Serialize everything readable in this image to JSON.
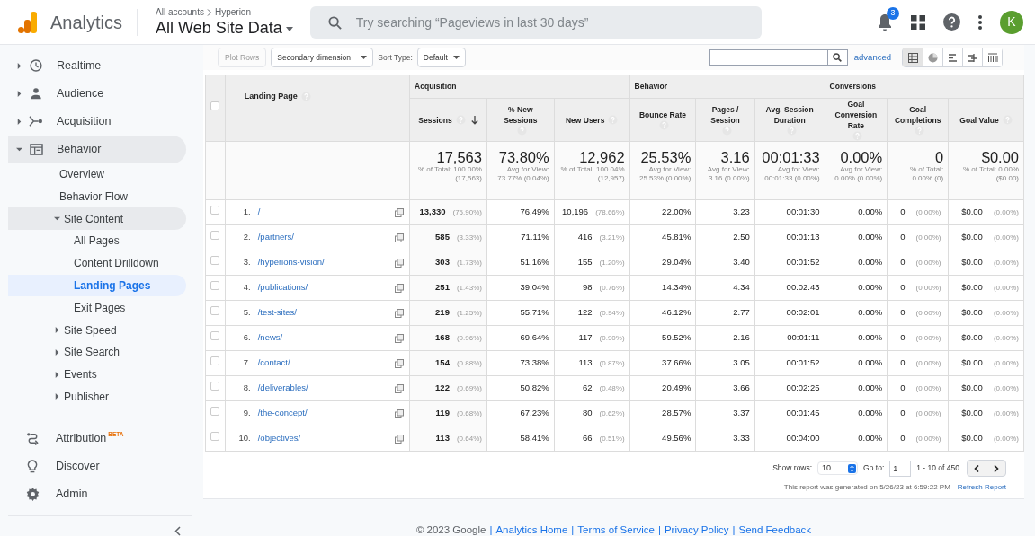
{
  "header": {
    "product": "Analytics",
    "breadcrumb": [
      "All accounts",
      "Hyperion"
    ],
    "property": "All Web Site Data",
    "search": {
      "placeholder": "Try searching “Pageviews in last 30 days”"
    },
    "notification_count": "3",
    "avatar_letter": "K"
  },
  "sidebar": {
    "items": [
      {
        "label": "Realtime",
        "expanded": false,
        "selected": false
      },
      {
        "label": "Audience",
        "expanded": false,
        "selected": false
      },
      {
        "label": "Acquisition",
        "expanded": false,
        "selected": false
      },
      {
        "label": "Behavior",
        "expanded": true,
        "selected": false,
        "children": [
          {
            "label": "Overview",
            "selected": false
          },
          {
            "label": "Behavior Flow",
            "selected": false
          },
          {
            "label": "Site Content",
            "expanded": true,
            "selected": false,
            "children": [
              {
                "label": "All Pages",
                "selected": false
              },
              {
                "label": "Content Drilldown",
                "selected": false
              },
              {
                "label": "Landing Pages",
                "selected": true
              },
              {
                "label": "Exit Pages",
                "selected": false
              }
            ]
          },
          {
            "label": "Site Speed",
            "expanded": false,
            "selected": false
          },
          {
            "label": "Site Search",
            "expanded": false,
            "selected": false
          },
          {
            "label": "Events",
            "expanded": false,
            "selected": false
          },
          {
            "label": "Publisher",
            "expanded": false,
            "selected": false
          }
        ]
      }
    ],
    "bottom_items": [
      {
        "label": "Attribution",
        "badge": "BETA",
        "selected": false
      },
      {
        "label": "Discover",
        "selected": false
      },
      {
        "label": "Admin",
        "selected": false
      }
    ]
  },
  "toolbar": {
    "plot_rows": {
      "label": "Plot Rows",
      "disabled": true
    },
    "secondary_dimension": "Secondary dimension",
    "sort_type_label": "Sort Type:",
    "sort_type": "Default",
    "advanced_link": "advanced",
    "views": [
      {
        "selected": true
      },
      {
        "selected": false
      },
      {
        "selected": false
      },
      {
        "selected": false
      },
      {
        "selected": false
      }
    ]
  },
  "table": {
    "header_checkbox": {
      "checked": false
    },
    "dimension": {
      "label": "Landing Page",
      "help": true
    },
    "groups": [
      {
        "label": "Acquisition",
        "columns": [
          {
            "label": "Sessions",
            "help": true,
            "sorted": true
          },
          {
            "label": "% New Sessions",
            "help": true,
            "sorted": false
          },
          {
            "label": "New Users",
            "help": true,
            "sorted": false
          }
        ]
      },
      {
        "label": "Behavior",
        "columns": [
          {
            "label": "Bounce Rate",
            "help": true,
            "sorted": false
          },
          {
            "label": "Pages / Session",
            "help": true,
            "sorted": false
          },
          {
            "label": "Avg. Session Duration",
            "help": true,
            "sorted": false
          }
        ]
      },
      {
        "label": "Conversions",
        "columns": [
          {
            "label": "Goal Conversion Rate",
            "help": true,
            "sorted": false
          },
          {
            "label": "Goal Completions",
            "help": true,
            "sorted": false
          },
          {
            "label": "Goal Value",
            "help": true,
            "sorted": false
          }
        ]
      }
    ],
    "totals": [
      {
        "value": "17,563",
        "note": "% of Total: 100.00% (17,563)"
      },
      {
        "value": "73.80%",
        "note": "Avg for View: 73.77% (0.04%)"
      },
      {
        "value": "12,962",
        "note": "% of Total: 100.04% (12,957)"
      },
      {
        "value": "25.53%",
        "note": "Avg for View: 25.53% (0.00%)"
      },
      {
        "value": "3.16",
        "note": "Avg for View: 3.16 (0.00%)"
      },
      {
        "value": "00:01:33",
        "note": "Avg for View: 00:01:33 (0.00%)"
      },
      {
        "value": "0.00%",
        "note": "Avg for View: 0.00% (0.00%)"
      },
      {
        "value": "0",
        "note": "% of Total: 0.00% (0)"
      },
      {
        "value": "$0.00",
        "note": "% of Total: 0.00% ($0.00)"
      }
    ],
    "rows": [
      {
        "checked": false,
        "index": "1.",
        "page": "/",
        "cells": [
          [
            "13,330",
            "(75.90%)"
          ],
          [
            "76.49%"
          ],
          [
            "10,196",
            "(78.66%)"
          ],
          [
            "22.00%"
          ],
          [
            "3.23"
          ],
          [
            "00:01:30"
          ],
          [
            "0.00%"
          ],
          [
            "0",
            "(0.00%)"
          ],
          [
            "$0.00",
            "(0.00%)"
          ]
        ]
      },
      {
        "checked": false,
        "index": "2.",
        "page": "/partners/",
        "cells": [
          [
            "585",
            "(3.33%)"
          ],
          [
            "71.11%"
          ],
          [
            "416",
            "(3.21%)"
          ],
          [
            "45.81%"
          ],
          [
            "2.50"
          ],
          [
            "00:01:13"
          ],
          [
            "0.00%"
          ],
          [
            "0",
            "(0.00%)"
          ],
          [
            "$0.00",
            "(0.00%)"
          ]
        ]
      },
      {
        "checked": false,
        "index": "3.",
        "page": "/hyperions-vision/",
        "cells": [
          [
            "303",
            "(1.73%)"
          ],
          [
            "51.16%"
          ],
          [
            "155",
            "(1.20%)"
          ],
          [
            "29.04%"
          ],
          [
            "3.40"
          ],
          [
            "00:01:52"
          ],
          [
            "0.00%"
          ],
          [
            "0",
            "(0.00%)"
          ],
          [
            "$0.00",
            "(0.00%)"
          ]
        ]
      },
      {
        "checked": false,
        "index": "4.",
        "page": "/publications/",
        "cells": [
          [
            "251",
            "(1.43%)"
          ],
          [
            "39.04%"
          ],
          [
            "98",
            "(0.76%)"
          ],
          [
            "14.34%"
          ],
          [
            "4.34"
          ],
          [
            "00:02:43"
          ],
          [
            "0.00%"
          ],
          [
            "0",
            "(0.00%)"
          ],
          [
            "$0.00",
            "(0.00%)"
          ]
        ]
      },
      {
        "checked": false,
        "index": "5.",
        "page": "/test-sites/",
        "cells": [
          [
            "219",
            "(1.25%)"
          ],
          [
            "55.71%"
          ],
          [
            "122",
            "(0.94%)"
          ],
          [
            "46.12%"
          ],
          [
            "2.77"
          ],
          [
            "00:02:01"
          ],
          [
            "0.00%"
          ],
          [
            "0",
            "(0.00%)"
          ],
          [
            "$0.00",
            "(0.00%)"
          ]
        ]
      },
      {
        "checked": false,
        "index": "6.",
        "page": "/news/",
        "cells": [
          [
            "168",
            "(0.96%)"
          ],
          [
            "69.64%"
          ],
          [
            "117",
            "(0.90%)"
          ],
          [
            "59.52%"
          ],
          [
            "2.16"
          ],
          [
            "00:01:11"
          ],
          [
            "0.00%"
          ],
          [
            "0",
            "(0.00%)"
          ],
          [
            "$0.00",
            "(0.00%)"
          ]
        ]
      },
      {
        "checked": false,
        "index": "7.",
        "page": "/contact/",
        "cells": [
          [
            "154",
            "(0.88%)"
          ],
          [
            "73.38%"
          ],
          [
            "113",
            "(0.87%)"
          ],
          [
            "37.66%"
          ],
          [
            "3.05"
          ],
          [
            "00:01:52"
          ],
          [
            "0.00%"
          ],
          [
            "0",
            "(0.00%)"
          ],
          [
            "$0.00",
            "(0.00%)"
          ]
        ]
      },
      {
        "checked": false,
        "index": "8.",
        "page": "/deliverables/",
        "cells": [
          [
            "122",
            "(0.69%)"
          ],
          [
            "50.82%"
          ],
          [
            "62",
            "(0.48%)"
          ],
          [
            "20.49%"
          ],
          [
            "3.66"
          ],
          [
            "00:02:25"
          ],
          [
            "0.00%"
          ],
          [
            "0",
            "(0.00%)"
          ],
          [
            "$0.00",
            "(0.00%)"
          ]
        ]
      },
      {
        "checked": false,
        "index": "9.",
        "page": "/the-concept/",
        "cells": [
          [
            "119",
            "(0.68%)"
          ],
          [
            "67.23%"
          ],
          [
            "80",
            "(0.62%)"
          ],
          [
            "28.57%"
          ],
          [
            "3.37"
          ],
          [
            "00:01:45"
          ],
          [
            "0.00%"
          ],
          [
            "0",
            "(0.00%)"
          ],
          [
            "$0.00",
            "(0.00%)"
          ]
        ]
      },
      {
        "checked": false,
        "index": "10.",
        "page": "/objectives/",
        "cells": [
          [
            "113",
            "(0.64%)"
          ],
          [
            "58.41%"
          ],
          [
            "66",
            "(0.51%)"
          ],
          [
            "49.56%"
          ],
          [
            "3.33"
          ],
          [
            "00:04:00"
          ],
          [
            "0.00%"
          ],
          [
            "0",
            "(0.00%)"
          ],
          [
            "$0.00",
            "(0.00%)"
          ]
        ]
      }
    ]
  },
  "pager": {
    "show_rows_label": "Show rows:",
    "show_rows": "10",
    "go_to_label": "Go to:",
    "go_to": "1",
    "range": "1 - 10 of 450",
    "generated": "This report was generated on 5/26/23 at 6:59:22 PM -",
    "refresh_link": "Refresh Report"
  },
  "footer": [
    {
      "kind": "text",
      "text": "© 2023 Google"
    },
    {
      "kind": "separator",
      "text": "|"
    },
    {
      "kind": "link",
      "text": "Analytics Home"
    },
    {
      "kind": "separator",
      "text": "|"
    },
    {
      "kind": "link",
      "text": "Terms of Service"
    },
    {
      "kind": "separator",
      "text": "|"
    },
    {
      "kind": "link",
      "text": "Privacy Policy"
    },
    {
      "kind": "separator",
      "text": "|"
    },
    {
      "kind": "link",
      "text": "Send Feedback"
    }
  ]
}
